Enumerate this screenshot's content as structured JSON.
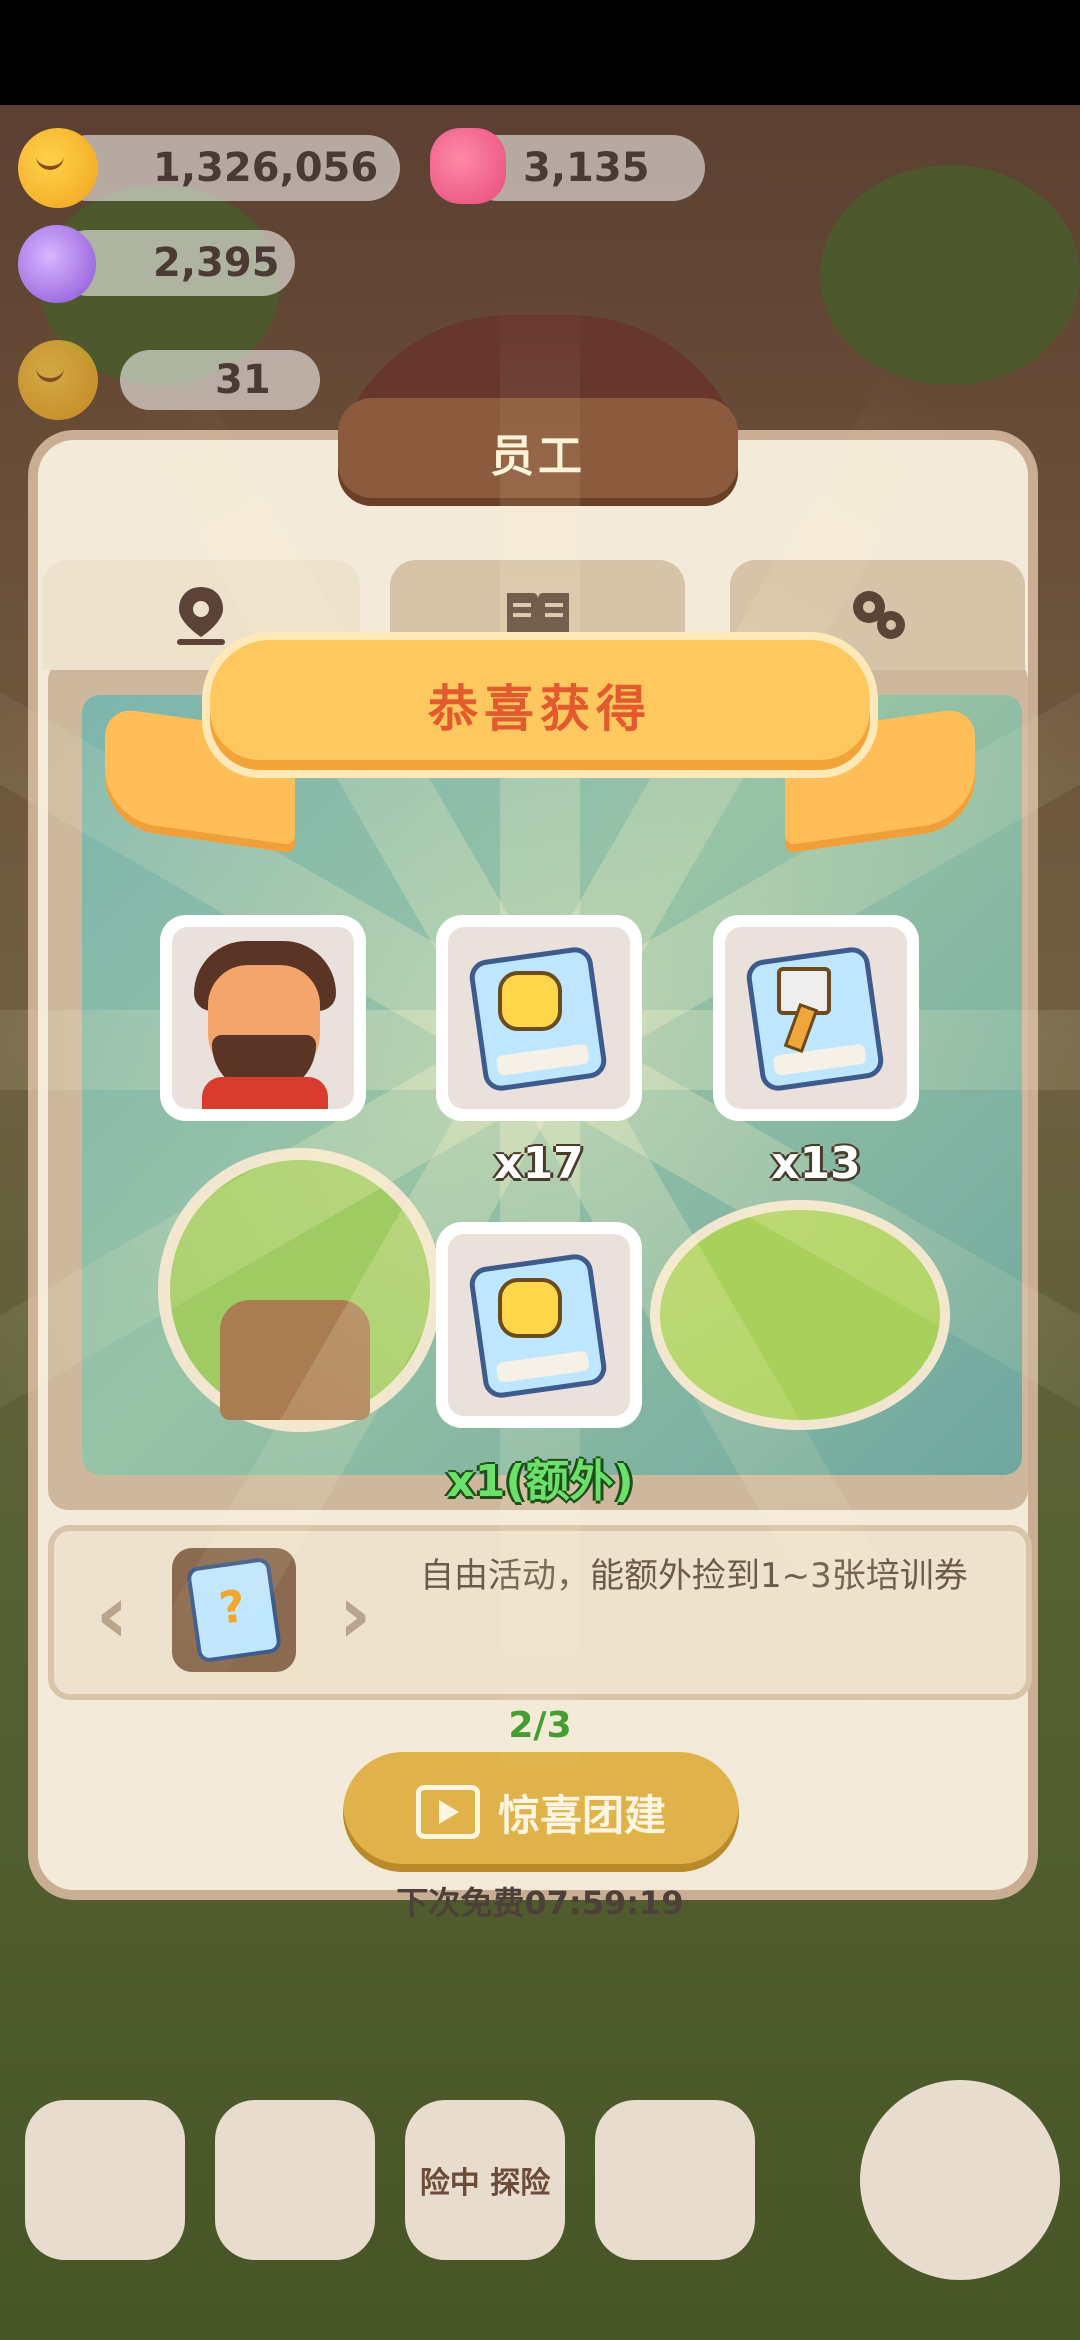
{
  "resources": {
    "coins": "1,326,056",
    "hearts": "3,135",
    "candy": "2,395",
    "staff_count": "31"
  },
  "dialog": {
    "title": "员工",
    "tabs": [
      {
        "icon": "map-pin-icon"
      },
      {
        "icon": "book-icon"
      },
      {
        "icon": "gear-icon"
      }
    ],
    "description": "自由活动，能额外捡到1~3张培训券",
    "progress": "2/3",
    "action_label": "惊喜团建",
    "free_timer": "下次免费07:59:19"
  },
  "reward": {
    "banner_title": "恭喜获得",
    "items": [
      {
        "name": "character-portrait",
        "qty": ""
      },
      {
        "name": "fist-ticket",
        "qty": "x17"
      },
      {
        "name": "spatula-ticket",
        "qty": "x13"
      },
      {
        "name": "fist-ticket-bonus",
        "qty": "x1(额外)"
      }
    ]
  },
  "dock": {
    "explore_label": "险中 探险"
  },
  "colors": {
    "banner": "#ffc85e",
    "banner_text": "#e35a2f",
    "bonus_text": "#6be06a",
    "progress": "#3c9b2a",
    "action_button": "#e0b24a"
  }
}
